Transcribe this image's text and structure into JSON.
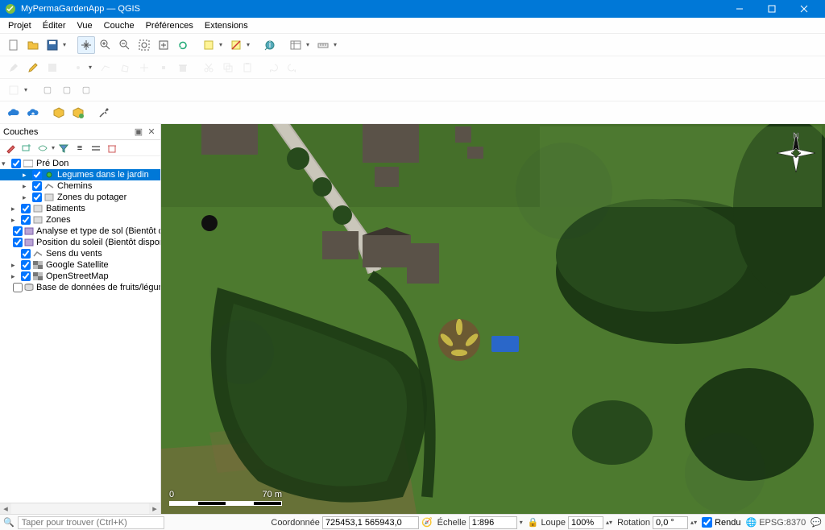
{
  "window": {
    "title": "MyPermaGardenApp — QGIS"
  },
  "menus": [
    "Projet",
    "Éditer",
    "Vue",
    "Couche",
    "Préférences",
    "Extensions"
  ],
  "menus_accel": [
    "P",
    "É",
    "V",
    "C",
    "P",
    "E"
  ],
  "panel": {
    "title": "Couches",
    "root": "Pré Don",
    "layers": [
      {
        "label": "Legumes dans le jardin",
        "checked": true,
        "selected": true,
        "expandable": true,
        "indent": 2,
        "icon": "point-green"
      },
      {
        "label": "Chemins",
        "checked": true,
        "selected": false,
        "expandable": true,
        "indent": 2,
        "icon": "line-grey"
      },
      {
        "label": "Zones du potager",
        "checked": true,
        "selected": false,
        "expandable": true,
        "indent": 2,
        "icon": "poly-grey"
      },
      {
        "label": "Batiments",
        "checked": true,
        "selected": false,
        "expandable": true,
        "indent": 1,
        "icon": "poly-grey"
      },
      {
        "label": "Zones",
        "checked": true,
        "selected": false,
        "expandable": true,
        "indent": 1,
        "icon": "poly-grey"
      },
      {
        "label": "Analyse et type de sol (Bientôt disponible)",
        "checked": true,
        "selected": false,
        "expandable": false,
        "indent": 1,
        "icon": "poly-purple"
      },
      {
        "label": "Position du soleil (Bientôt disponible)",
        "checked": true,
        "selected": false,
        "expandable": false,
        "indent": 1,
        "icon": "poly-purple"
      },
      {
        "label": "Sens du vents",
        "checked": true,
        "selected": false,
        "expandable": false,
        "indent": 1,
        "icon": "line-grey"
      },
      {
        "label": "Google Satellite",
        "checked": true,
        "selected": false,
        "expandable": true,
        "indent": 1,
        "icon": "raster"
      },
      {
        "label": "OpenStreetMap",
        "checked": true,
        "selected": false,
        "expandable": true,
        "indent": 1,
        "icon": "raster"
      },
      {
        "label": "Base de données de fruits/légumes/plantes",
        "checked": false,
        "selected": false,
        "expandable": false,
        "indent": 1,
        "icon": "db"
      }
    ]
  },
  "scalebar": {
    "left": "0",
    "right": "70 m"
  },
  "status": {
    "locator_placeholder": "Taper pour trouver (Ctrl+K)",
    "coord_label": "Coordonnée",
    "coord_value": "725453,1 565943,0",
    "scale_label": "Échelle",
    "scale_value": "1:896",
    "loupe_label": "Loupe",
    "loupe_value": "100%",
    "rotation_label": "Rotation",
    "rotation_value": "0,0 °",
    "render_label": "Rendu",
    "crs_value": "EPSG:8370"
  }
}
